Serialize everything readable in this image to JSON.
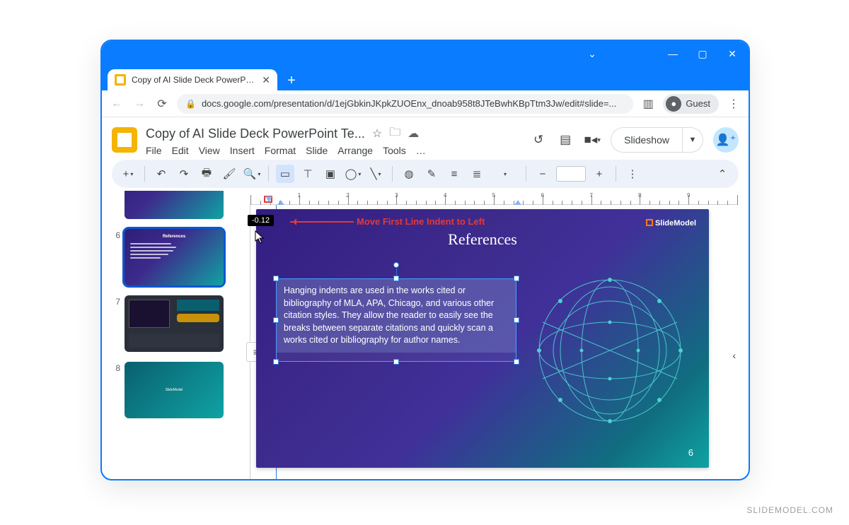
{
  "window_controls": {
    "minimize": "—",
    "maximize": "▢",
    "close": "✕",
    "chevron": "⌄"
  },
  "browser": {
    "tab_title": "Copy of AI Slide Deck PowerPoint",
    "url": "docs.google.com/presentation/d/1ejGbkinJKpkZUOEnx_dnoab958t8JTeBwhKBpTtm3Jw/edit#slide=...",
    "guest_label": "Guest"
  },
  "doc": {
    "title": "Copy of AI Slide Deck PowerPoint Te...",
    "menus": [
      "File",
      "Edit",
      "View",
      "Insert",
      "Format",
      "Slide",
      "Arrange",
      "Tools",
      "…"
    ],
    "slideshow_label": "Slideshow"
  },
  "ruler": {
    "tooltip_value": "-0.12",
    "indent_marker_pos_pct": 3.8,
    "left_indent_pos_pct": 6.2,
    "right_margin_pos_pct": 55
  },
  "annotation": {
    "text": "Move First Line Indent to Left"
  },
  "slide": {
    "title": "References",
    "body": "Hanging indents are used in the works cited or bibliography of MLA, APA, Chicago, and various other citation styles. They allow the reader to easily see the breaks between separate citations and quickly scan a works cited or bibliography for author names.",
    "logo": "SlideModel",
    "page_number": "6"
  },
  "thumbnails": [
    {
      "num": "",
      "label": "",
      "type": "partial"
    },
    {
      "num": "6",
      "label": "References",
      "type": "ref",
      "selected": true
    },
    {
      "num": "7",
      "label": "",
      "type": "download"
    },
    {
      "num": "8",
      "label": "SlideModel",
      "type": "logo"
    }
  ],
  "footer_brand": "SLIDEMODEL.COM"
}
